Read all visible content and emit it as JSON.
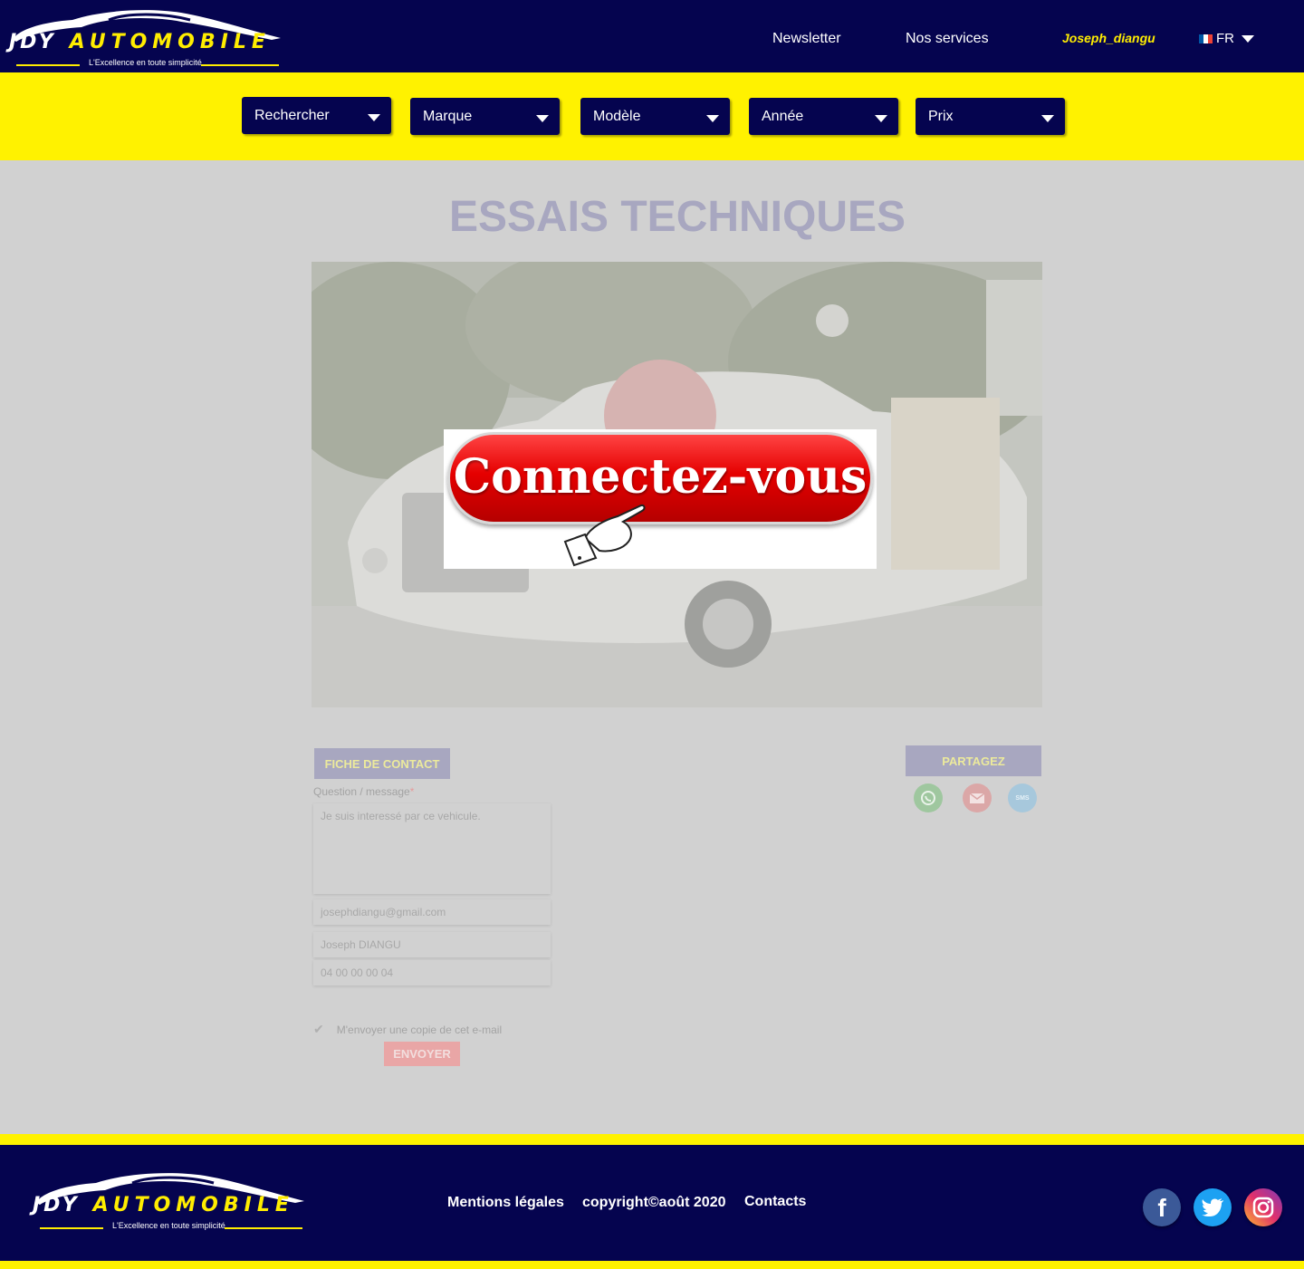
{
  "header": {
    "logo": {
      "brand_left": "JDY",
      "brand_right": "AUTOMOBILE",
      "tagline": "L'Excellence en toute simplicité"
    },
    "nav": [
      {
        "label": "Newsletter"
      },
      {
        "label": "Nos services"
      }
    ],
    "user": "Joseph_diangu",
    "language": "FR"
  },
  "filters": [
    {
      "label": "Rechercher"
    },
    {
      "label": "Marque"
    },
    {
      "label": "Modèle"
    },
    {
      "label": "Année"
    },
    {
      "label": "Prix"
    }
  ],
  "main": {
    "title": "ESSAIS TECHNIQUES",
    "login_prompt": "Connectez-vous"
  },
  "contact": {
    "heading": "FICHE DE CONTACT",
    "question_label": "Question / message",
    "required_mark": "*",
    "message_value": "Je suis interessé par ce vehicule.",
    "email_value": "josephdiangu@gmail.com",
    "name_value": "Joseph DIANGU",
    "phone_value": "04 00 00 00 04",
    "copy_label": "M'envoyer une copie de cet e-mail",
    "send_label": "ENVOYER"
  },
  "share": {
    "heading": "PARTAGEZ",
    "icons": [
      "whatsapp-icon",
      "email-icon",
      "sms-icon"
    ],
    "sms_text": "SMS"
  },
  "footer": {
    "links": [
      {
        "label": "Mentions légales"
      },
      {
        "label": "copyright©août 2020"
      },
      {
        "label": "Contacts"
      }
    ],
    "social": [
      "facebook-icon",
      "twitter-icon",
      "instagram-icon"
    ]
  },
  "colors": {
    "navy": "#05044f",
    "yellow": "#fff200",
    "overlay_gray": "#d1d1d1",
    "login_red": "#e50000"
  }
}
